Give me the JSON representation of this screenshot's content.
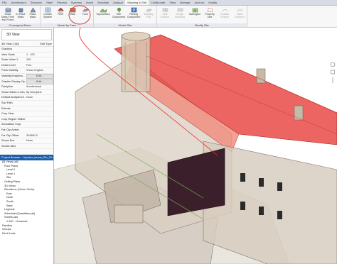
{
  "ribbon_tabs": [
    "File",
    "Architecture",
    "Structure",
    "Steel",
    "Precast",
    "Systems",
    "Insert",
    "Annotate",
    "Analyze",
    "Massing & Site",
    "Collaborate",
    "View",
    "Manage",
    "Add-Ins",
    "Modify"
  ],
  "active_tab_index": 9,
  "ribbon": {
    "conceptual_mass": {
      "title": "Conceptual Mass",
      "tools": [
        "Show Mass Form and Floors",
        "In-Place Mass",
        "Place Mass"
      ]
    },
    "model_by_face": {
      "title": "Model by Face",
      "tools": [
        "Curtain System",
        "Roof",
        "Wall",
        "Floor"
      ]
    },
    "model_site": {
      "title": "Model Site",
      "tools": [
        "Toposurface",
        "Site Component",
        "Parking Component",
        "Building Pad"
      ]
    },
    "modify_site": {
      "title": "Modify Site",
      "tools": [
        "Split Surface",
        "Merge Surfaces",
        "Subregion",
        "Property Line",
        "Graded Region",
        "Label Contours"
      ]
    }
  },
  "properties": {
    "type_name": "3D View",
    "selector": "3D View: {3D}",
    "edit_type": "Edit Type",
    "rows": [
      {
        "k": "Graphics",
        "v": ""
      },
      {
        "k": "View Scale",
        "v": "1 : 100"
      },
      {
        "k": "Scale Value 1:",
        "v": "100"
      },
      {
        "k": "Detail Level",
        "v": "Fine"
      },
      {
        "k": "Parts Visibility",
        "v": "Show Original"
      },
      {
        "k": "Visibility/Graphics...",
        "v": "Edit...",
        "btn": true
      },
      {
        "k": "Graphic Display Op...",
        "v": "Edit...",
        "btn": true
      },
      {
        "k": "Discipline",
        "v": "Architectural"
      },
      {
        "k": "Show Hidden Lines",
        "v": "By Discipline"
      },
      {
        "k": "Default Analysis Di...",
        "v": "None"
      },
      {
        "k": "Sun Path",
        "v": ""
      },
      {
        "k": "Extents",
        "v": ""
      },
      {
        "k": "Crop View",
        "v": ""
      },
      {
        "k": "Crop Region Visible",
        "v": ""
      },
      {
        "k": "Annotation Crop",
        "v": ""
      },
      {
        "k": "Far Clip Active",
        "v": ""
      },
      {
        "k": "Far Clip Offset",
        "v": "304800.0"
      },
      {
        "k": "Scope Box",
        "v": "None"
      },
      {
        "k": "Section Box",
        "v": ""
      }
    ]
  },
  "project_browser": {
    "title": "Project Browser - Liquidez_lauma_Rlo_02.rvt",
    "tree": [
      "[0] Views (all)",
      "Floor Plans",
      "Level 0",
      "Level 1",
      "Site",
      "Ceiling Plans",
      "3D Views",
      "Elevations (12mm Circle)",
      "East",
      "North",
      "South",
      "West",
      "Legends",
      "Schedules/Quantities (all)",
      "Sheets (all)",
      "1:100 - Unnamed",
      "Families",
      "Groups",
      "Revit Links"
    ]
  },
  "colors": {
    "accent": "#1d5ea8",
    "highlight_red": "#e5322d",
    "wall_dark": "#3b1f2a"
  }
}
